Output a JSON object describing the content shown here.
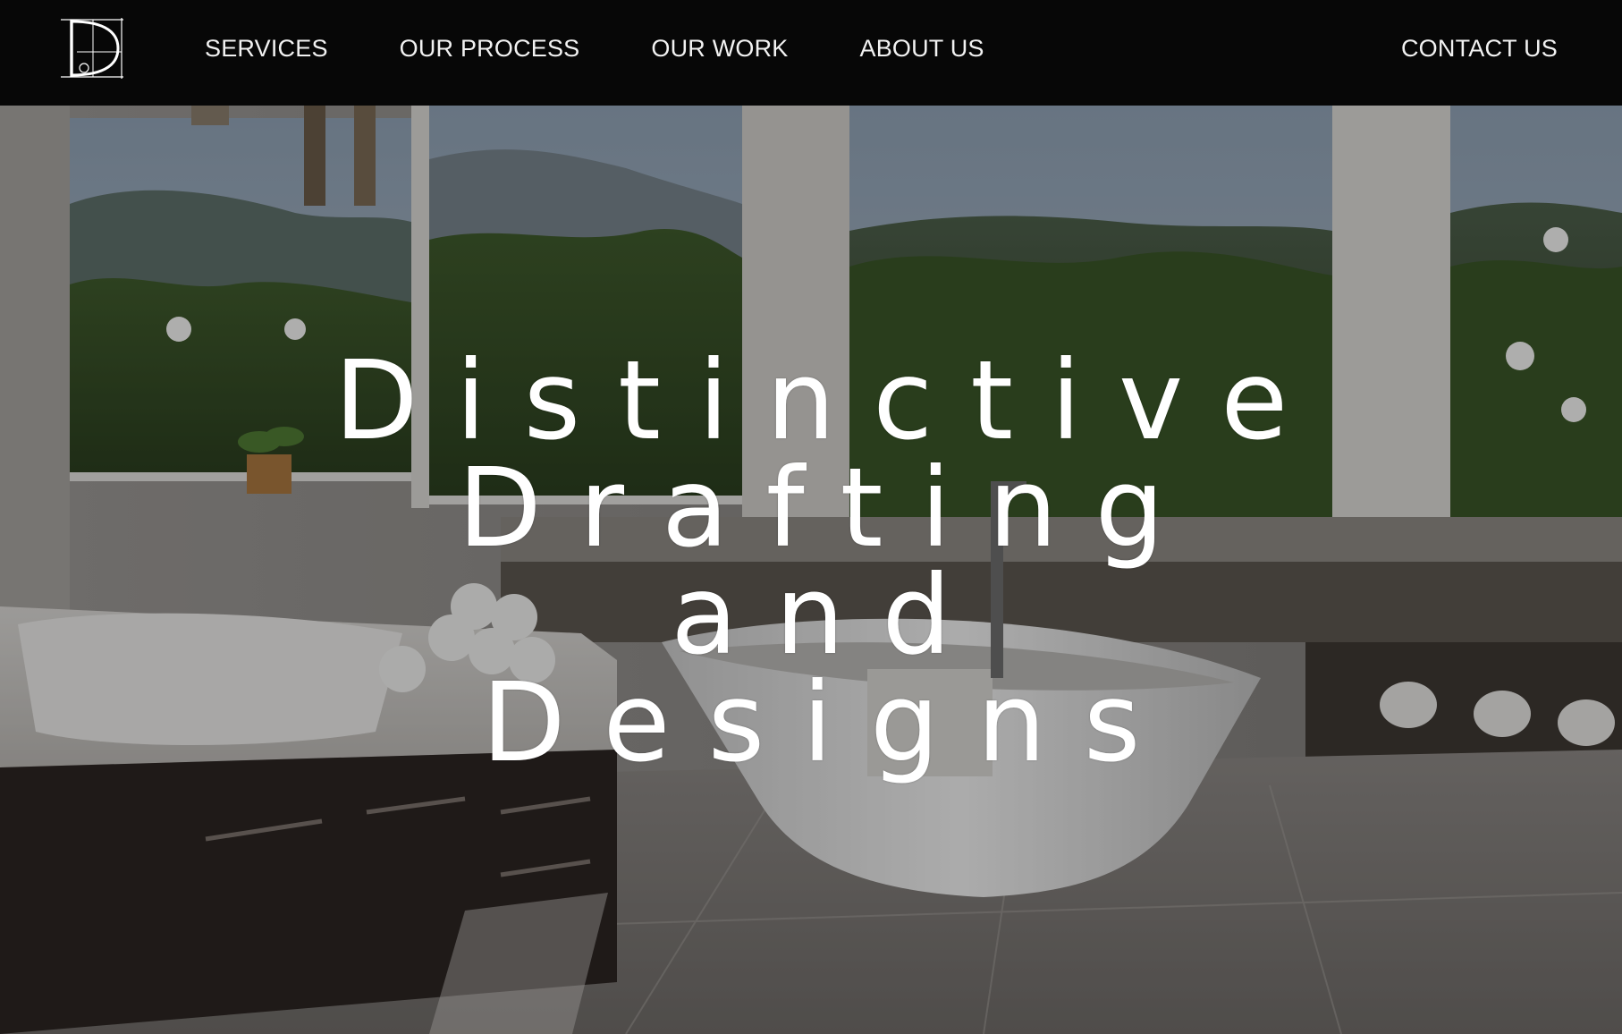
{
  "brand": {
    "logo_letter": "D",
    "logo_icon": "monogram-d-logo"
  },
  "nav": {
    "items": [
      {
        "label": "SERVICES"
      },
      {
        "label": "OUR PROCESS"
      },
      {
        "label": "OUR WORK"
      },
      {
        "label": "ABOUT US"
      }
    ],
    "contact_label": "CONTACT US"
  },
  "hero": {
    "title_lines": [
      "Distinctive",
      "Drafting",
      "and",
      "Designs"
    ],
    "background_icon": "bathroom-interior-photo"
  },
  "colors": {
    "nav_bg": "#070707",
    "nav_text": "#f2f2f2",
    "hero_text": "#ffffff"
  }
}
